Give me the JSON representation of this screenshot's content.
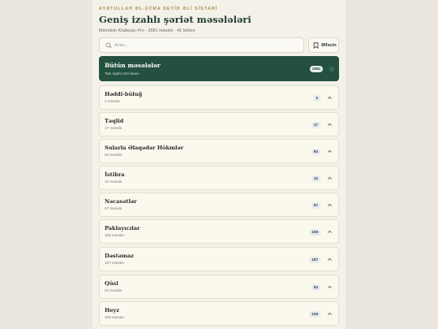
{
  "header": {
    "supertitle": "AYƏTULLAH ƏL-ÜZMA SEYİD ƏLİ SİSTANİ",
    "title": "Geniş izahlı şəriət məsələləri",
    "subtitle": "Mömünin Kitabçası Pro · 2681 məsələ · 41 bölmə"
  },
  "search": {
    "placeholder": "Axtar...",
    "icon": "search-icon"
  },
  "favorites": {
    "label": "Əlfəcin",
    "icon": "bookmark-icon"
  },
  "all_card": {
    "title": "Bütün məsələlər",
    "subtitle": "Tam siyahı üzrə baxın",
    "count": "2681",
    "accent": "#23503f"
  },
  "categories": [
    {
      "title": "Həddi-büluğ",
      "subtitle": "2 məsələ",
      "count": "2"
    },
    {
      "title": "Təqlid",
      "subtitle": "17 məsələ",
      "count": "17"
    },
    {
      "title": "Sularla Əlaqədar Hökmlər",
      "subtitle": "63 məsələ",
      "count": "63"
    },
    {
      "title": "İstibra",
      "subtitle": "12 məsələ",
      "count": "12"
    },
    {
      "title": "Nəcasətlər",
      "subtitle": "57 məsələ",
      "count": "57"
    },
    {
      "title": "Paklayıcılar",
      "subtitle": "105 məsələ",
      "count": "105"
    },
    {
      "title": "Dəstəmaz",
      "subtitle": "157 məsələ",
      "count": "157"
    },
    {
      "title": "Qüsl",
      "subtitle": "53 məsələ",
      "count": "53"
    },
    {
      "title": "Heyz",
      "subtitle": "109 məsələ",
      "count": "109"
    }
  ]
}
